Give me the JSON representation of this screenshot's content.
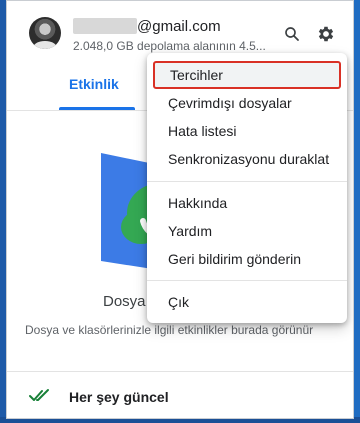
{
  "account": {
    "email_domain": "@gmail.com",
    "storage": "2.048,0 GB depolama alanının 4.5..."
  },
  "tabs": [
    {
      "label": "Etkinlik"
    }
  ],
  "empty_state": {
    "title": "Dosya",
    "description": "Dosya ve klasörlerinizle ilgili etkinlikler burada görünür"
  },
  "footer": {
    "status": "Her şey güncel"
  },
  "menu": {
    "items": [
      {
        "label": "Tercihler"
      },
      {
        "label": "Çevrimdışı dosyalar"
      },
      {
        "label": "Hata listesi"
      },
      {
        "label": "Senkronizasyonu duraklat"
      },
      {
        "label": "Hakkında"
      },
      {
        "label": "Yardım"
      },
      {
        "label": "Geri bildirim gönderin"
      },
      {
        "label": "Çık"
      }
    ]
  },
  "colors": {
    "accent": "#1a73e8",
    "highlight_border": "#d93025",
    "success": "#188038"
  },
  "icons": {
    "search": "search-icon",
    "settings": "gear-icon",
    "status": "double-check-icon"
  }
}
